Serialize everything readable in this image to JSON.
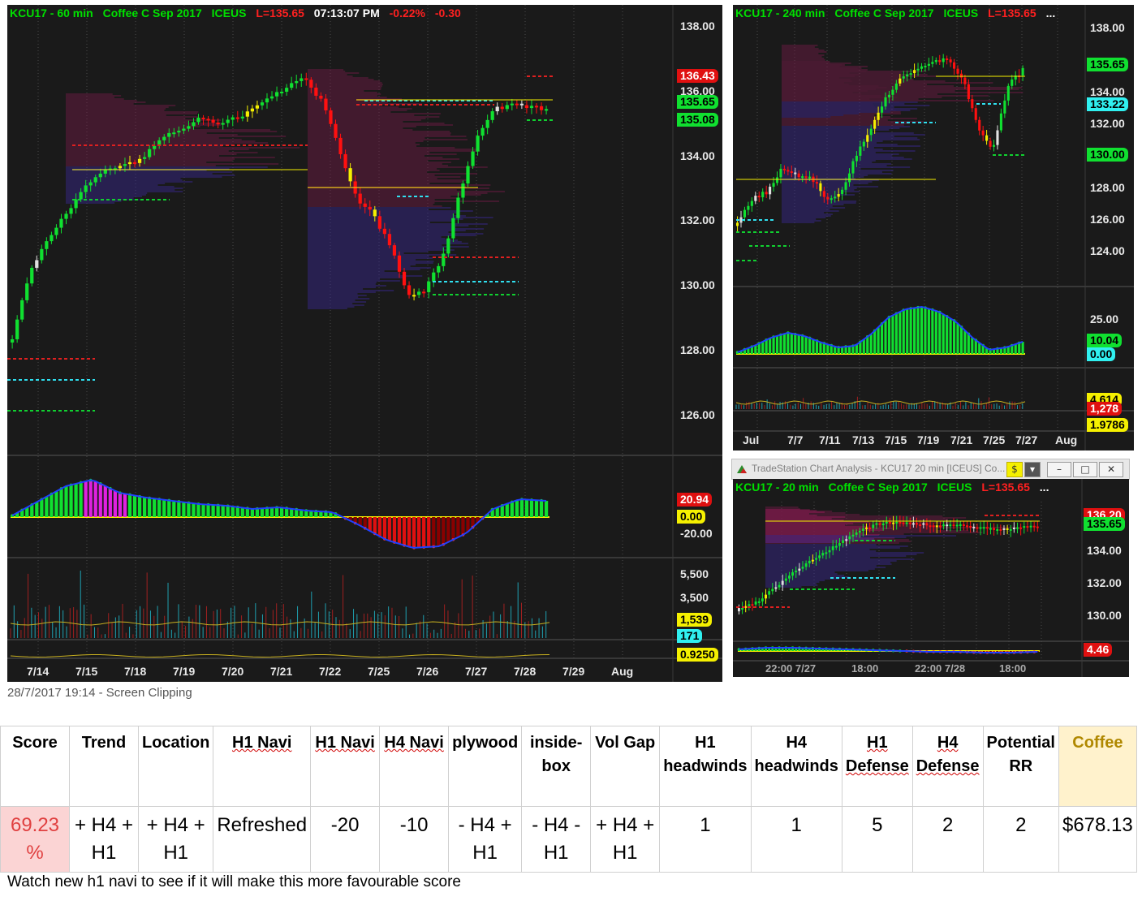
{
  "main_chart": {
    "symbol": "KCU17 - 60 min",
    "contract": "Coffee C Sep 2017",
    "exchange": "ICEUS",
    "last": "L=135.65",
    "time": "07:13:07 PM",
    "pct_change": "-0.22%",
    "change": "-0.30",
    "price_axis": [
      "138.00",
      "136.00",
      "134.00",
      "132.00",
      "130.00",
      "128.00",
      "126.00"
    ],
    "price_tags": [
      "136.43",
      "135.65",
      "135.08"
    ],
    "osc_tags": [
      "20.94",
      "0.00"
    ],
    "osc_axis": [
      "-20.00"
    ],
    "vol_axis": [
      "5,500",
      "3,500"
    ],
    "vol_tags": [
      "1,539",
      "171",
      "0.9250"
    ],
    "dates": [
      "7/14",
      "7/15",
      "7/18",
      "7/19",
      "7/20",
      "7/21",
      "7/22",
      "7/25",
      "7/26",
      "7/27",
      "7/28",
      "7/29",
      "Aug"
    ]
  },
  "chart_240": {
    "symbol": "KCU17 - 240 min",
    "contract": "Coffee C Sep 2017",
    "exchange": "ICEUS",
    "last": "L=135.65",
    "more": "...",
    "price_axis": [
      "138.00",
      "134.00",
      "132.00",
      "128.00",
      "126.00",
      "124.00"
    ],
    "price_tags": [
      "135.65",
      "133.22",
      "130.00"
    ],
    "osc_axis": [
      "25.00"
    ],
    "osc_tags": [
      "10.04",
      "0.00"
    ],
    "vol_tags": [
      "4,614",
      "1,278",
      "1.9786"
    ],
    "dates": [
      "Jul",
      "7/7",
      "7/11",
      "7/13",
      "7/15",
      "7/19",
      "7/21",
      "7/25",
      "7/27",
      "Aug"
    ]
  },
  "chart_20": {
    "window_title": "TradeStation Chart Analysis - KCU17 20 min [ICEUS] Co...",
    "symbol": "KCU17 - 20 min",
    "contract": "Coffee C Sep 2017",
    "exchange": "ICEUS",
    "last": "L=135.65",
    "more": "...",
    "price_axis": [
      "134.00",
      "132.00",
      "130.00"
    ],
    "price_tags": [
      "136.20",
      "135.65"
    ],
    "osc_tags": [
      "4.46"
    ],
    "times": [
      "22:00 7/27",
      "18:00",
      "22:00 7/28",
      "18:00"
    ]
  },
  "caption": "28/7/2017 19:14 - Screen Clipping",
  "table": {
    "headers": [
      "Score",
      "Trend",
      "Location",
      "H1 Navi",
      "H1 Navi",
      "H4 Navi",
      "plywood",
      "inside-box",
      "Vol Gap",
      "H1 headwinds",
      "H4 headwinds",
      "H1 Defense",
      "H4 Defense",
      "Potential RR",
      "Coffee"
    ],
    "values": [
      "69.23 %",
      "+ H4 + H1",
      "+ H4 + H1",
      "Refreshed",
      "-20",
      "-10",
      "- H4 + H1",
      "- H4 - H1",
      "+ H4 + H1",
      "1",
      "1",
      "5",
      "2",
      "2",
      "$678.13"
    ],
    "score_bg": "#fbd4d4",
    "coffee_bg": "#fff2cc"
  },
  "note": "Watch new h1 navi to see if it will make this more favourable score",
  "colors": {
    "up": "#10e030",
    "down": "#ff1010",
    "chart_bg": "#1a1a1a",
    "accent_yellow": "#f5f000",
    "accent_cyan": "#30f0f0"
  }
}
